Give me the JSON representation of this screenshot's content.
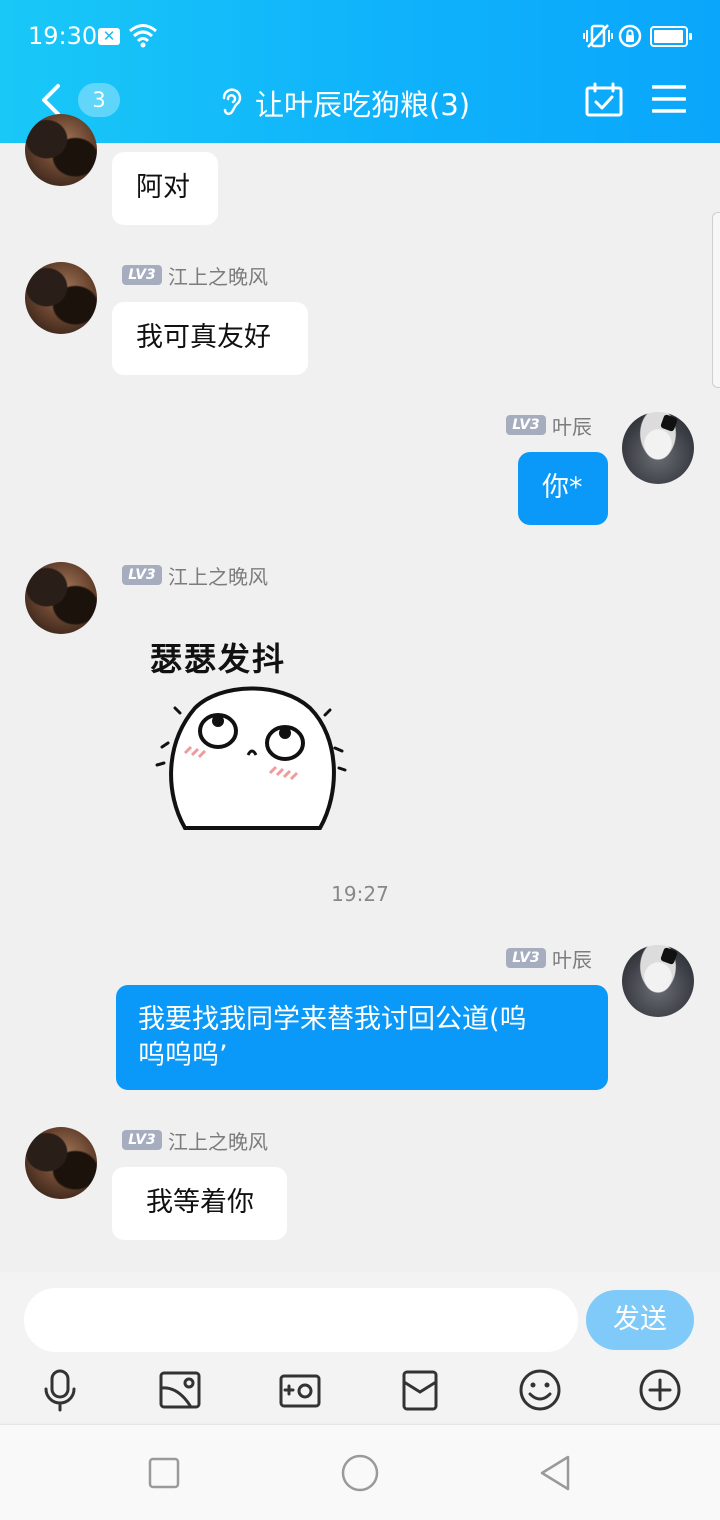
{
  "status_bar": {
    "time": "19:30",
    "notification_badge": "✕"
  },
  "header": {
    "unread_count": "3",
    "title": "让叶辰吃狗粮(3)"
  },
  "messages": [
    {
      "side": "left",
      "text": "阿对"
    },
    {
      "side": "left",
      "level": "LV3",
      "sender": "江上之晚风",
      "text": "我可真友好"
    },
    {
      "side": "right",
      "level": "LV3",
      "sender": "叶辰",
      "text": "你*"
    },
    {
      "side": "left",
      "level": "LV3",
      "sender": "江上之晚风",
      "sticker_caption": "瑟瑟发抖"
    },
    {
      "side": "right",
      "level": "LV3",
      "sender": "叶辰",
      "text_line1": "我要找我同学来替我讨回公道(呜",
      "text_line2": "呜呜呜’"
    },
    {
      "side": "left",
      "level": "LV3",
      "sender": "江上之晚风",
      "text": "我等着你"
    }
  ],
  "time_divider": "19:27",
  "input": {
    "value": "",
    "send_label": "发送"
  },
  "toolbar": [
    "microphone-icon",
    "image-icon",
    "camera-icon",
    "red-packet-icon",
    "emoji-icon",
    "plus-icon"
  ],
  "colors": {
    "header_gradient_start": "#19c8f7",
    "header_gradient_end": "#0aa6fb",
    "outgoing_bubble": "#0a99f8",
    "send_button": "#7fcaf8",
    "level_badge": "#a6adbf"
  }
}
